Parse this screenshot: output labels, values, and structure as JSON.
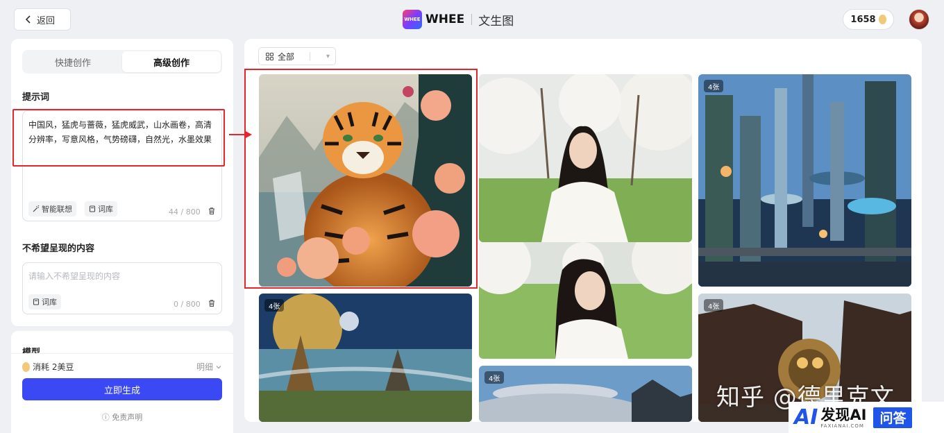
{
  "header": {
    "back_label": "返回",
    "logo_text": "WHEE",
    "logo_mark": "WHEE",
    "page_name": "文生图",
    "credits": "1658"
  },
  "mode_tabs": [
    {
      "label": "快捷创作",
      "active": false
    },
    {
      "label": "高级创作",
      "active": true
    }
  ],
  "prompt": {
    "label": "提示词",
    "value": "中国风，猛虎与蔷薇，猛虎威武，山水画卷，高清分辨率，写意风格，气势磅礴，自然光，水墨效果",
    "assist_chip": "智能联想",
    "library_chip": "词库",
    "counter": "44 / 800"
  },
  "negative": {
    "label": "不希望呈现的内容",
    "placeholder": "请输入不希望呈现的内容",
    "library_chip": "词库",
    "counter": "0 / 800"
  },
  "model": {
    "label": "模型",
    "cost": "消耗 2美豆",
    "detail": "明细",
    "generate": "立即生成",
    "disclaimer": "免责声明"
  },
  "gallery": {
    "filter": "全部",
    "items": [
      {
        "name": "tiger-roses",
        "badge": ""
      },
      {
        "name": "woman-blossoms-top",
        "badge": ""
      },
      {
        "name": "futuristic-city",
        "badge": "4张"
      },
      {
        "name": "woman-blossoms-bottom",
        "badge": ""
      },
      {
        "name": "fantasy-landscape",
        "badge": "4张"
      },
      {
        "name": "ufo-sky",
        "badge": "4张"
      },
      {
        "name": "steampunk-temple",
        "badge": "4张"
      }
    ]
  },
  "watermark": {
    "text": "知乎 @德里克文",
    "brand_ai": "AI",
    "brand_main": "发现AI",
    "brand_sub": "FAXIANAI.COM",
    "brand_tag": "问答"
  },
  "colors": {
    "accent": "#3b49f5",
    "highlight": "#e8242a"
  }
}
